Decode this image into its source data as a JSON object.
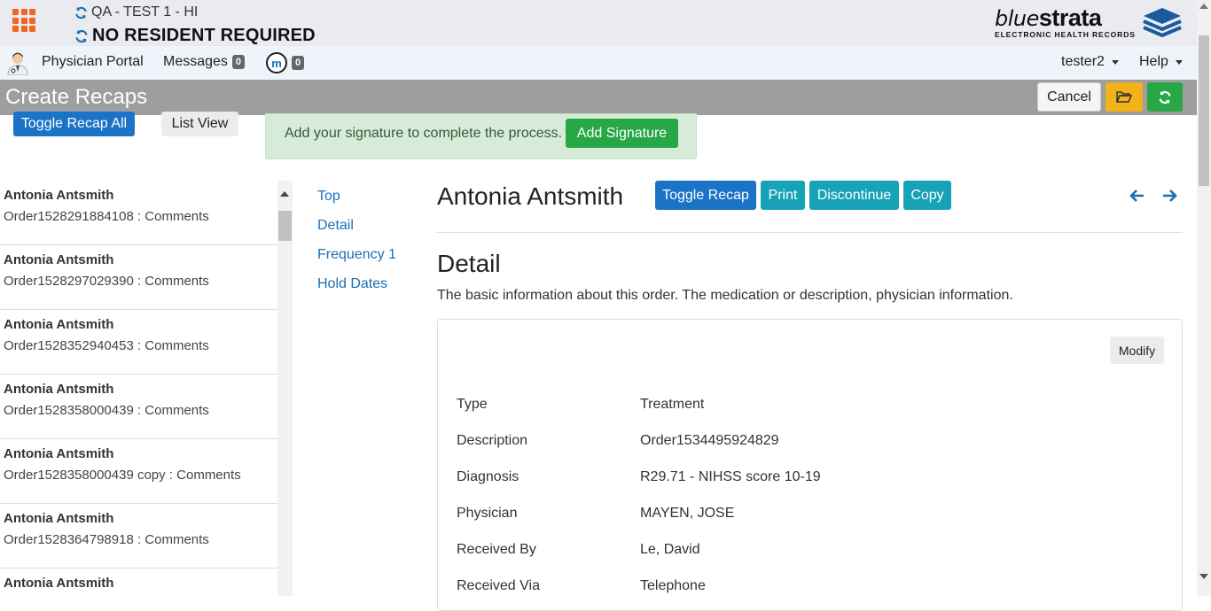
{
  "header": {
    "facility": "QA - TEST 1 - HI",
    "resident": "NO RESIDENT REQUIRED",
    "logo_light": "blue",
    "logo_bold": "strata",
    "logo_tagline": "ELECTRONIC HEALTH RECORDS"
  },
  "nav": {
    "portal": "Physician Portal",
    "messages": "Messages",
    "messages_count": "0",
    "m_label": "m",
    "m_count": "0",
    "user": "tester2",
    "help": "Help"
  },
  "titlebar": {
    "title": "Create Recaps",
    "cancel": "Cancel"
  },
  "actions": {
    "toggle_all": "Toggle Recap All",
    "list_view": "List View",
    "signature_prompt": "Add your signature to complete the process.",
    "add_signature": "Add Signature"
  },
  "orders": [
    {
      "name": "Antonia Antsmith",
      "desc": "Order1528291884108 : Comments"
    },
    {
      "name": "Antonia Antsmith",
      "desc": "Order1528297029390 : Comments"
    },
    {
      "name": "Antonia Antsmith",
      "desc": "Order1528352940453 : Comments"
    },
    {
      "name": "Antonia Antsmith",
      "desc": "Order1528358000439 : Comments"
    },
    {
      "name": "Antonia Antsmith",
      "desc": "Order1528358000439 copy : Comments"
    },
    {
      "name": "Antonia Antsmith",
      "desc": "Order1528364798918 : Comments"
    },
    {
      "name": "Antonia Antsmith",
      "desc": ""
    }
  ],
  "sections": [
    "Top",
    "Detail",
    "Frequency 1",
    "Hold Dates"
  ],
  "detail": {
    "patient_name": "Antonia Antsmith",
    "toggle_recap": "Toggle Recap",
    "print": "Print",
    "discontinue": "Discontinue",
    "copy": "Copy",
    "heading": "Detail",
    "description": "The basic information about this order. The medication or description, physician information.",
    "modify": "Modify",
    "fields": [
      {
        "label": "Type",
        "value": "Treatment"
      },
      {
        "label": "Description",
        "value": "Order1534495924829"
      },
      {
        "label": "Diagnosis",
        "value": "R29.71 - NIHSS score 10-19"
      },
      {
        "label": "Physician",
        "value": "MAYEN, JOSE"
      },
      {
        "label": "Received By",
        "value": "Le, David"
      },
      {
        "label": "Received Via",
        "value": "Telephone"
      }
    ]
  },
  "colors": {
    "accent_orange": "#f26522",
    "primary_blue": "#1a73c7",
    "info_teal": "#17a2b8",
    "success_green": "#28a745",
    "warning_yellow": "#f2b21a"
  },
  "icons": [
    "apps-grid-icon",
    "sync-icon",
    "doctor-avatar-icon",
    "m-icon",
    "folder-open-icon",
    "refresh-icon",
    "arrow-left-icon",
    "arrow-right-icon",
    "bluestrata-stack-icon"
  ]
}
